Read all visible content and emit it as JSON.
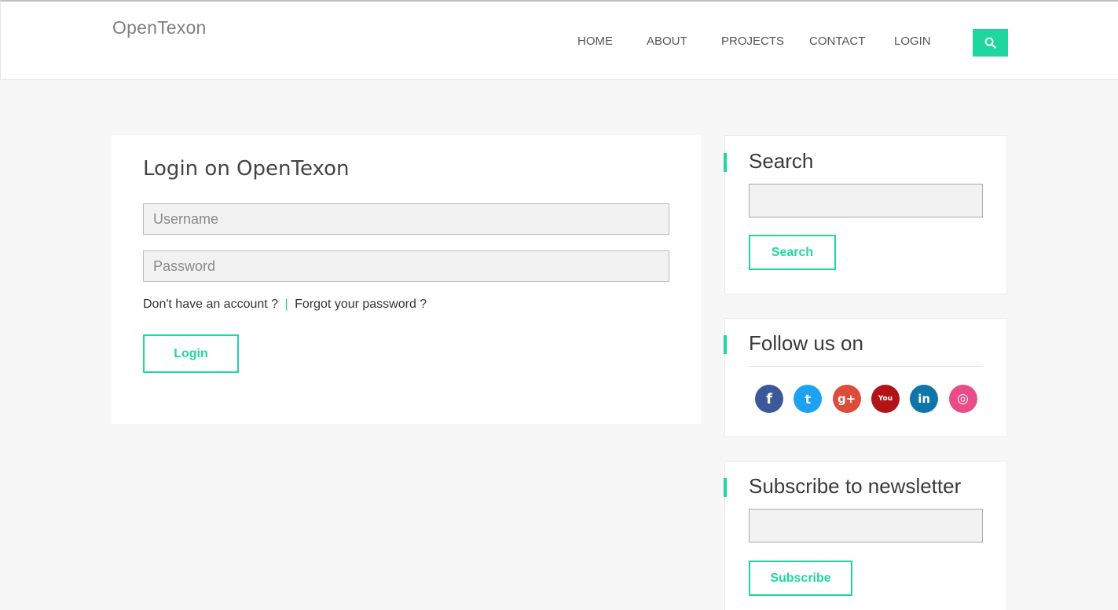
{
  "brand": {
    "name": "OpenTexon"
  },
  "nav": {
    "items": [
      {
        "label": "HOME"
      },
      {
        "label": "ABOUT"
      },
      {
        "label": "PROJECTS"
      },
      {
        "label": "CONTACT"
      },
      {
        "label": "LOGIN"
      }
    ],
    "search_icon": "search-icon"
  },
  "login": {
    "title": "Login on OpenTexon",
    "username_placeholder": "Username",
    "password_placeholder": "Password",
    "no_account_link": "Don't have an account ?",
    "separator": "|",
    "forgot_link": "Forgot your password ?",
    "submit_label": "Login"
  },
  "sidebar": {
    "search": {
      "title": "Search",
      "button_label": "Search"
    },
    "follow": {
      "title": "Follow us on",
      "networks": [
        {
          "name": "facebook-icon",
          "glyph": "f",
          "color": "#3b5998"
        },
        {
          "name": "twitter-icon",
          "glyph": "t",
          "color": "#1da1f2"
        },
        {
          "name": "google-plus-icon",
          "glyph": "g+",
          "color": "#dd4b39"
        },
        {
          "name": "youtube-icon",
          "glyph": "You",
          "color": "#b31217"
        },
        {
          "name": "linkedin-icon",
          "glyph": "in",
          "color": "#0e76a8"
        },
        {
          "name": "dribbble-icon",
          "glyph": "◎",
          "color": "#ea4c89"
        }
      ]
    },
    "newsletter": {
      "title": "Subscribe to newsletter",
      "button_label": "Subscribe"
    }
  },
  "colors": {
    "accent": "#1ed79f"
  }
}
